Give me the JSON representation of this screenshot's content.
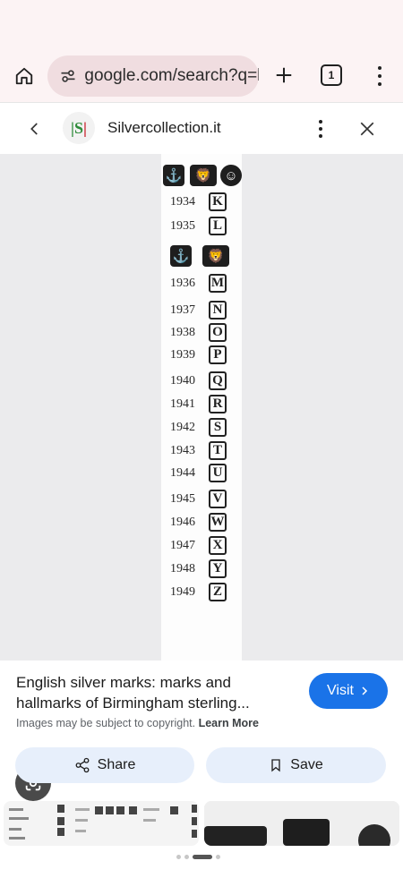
{
  "browser": {
    "url": "google.com/search?q=h",
    "tab_count": "1",
    "icons": [
      "home-icon",
      "tune-icon",
      "plus-icon",
      "tabs-icon",
      "more-vert-icon"
    ]
  },
  "sheet": {
    "site_name": "Silvercollection.it",
    "logo_text": [
      "|S",
      "S",
      "|"
    ]
  },
  "hallmarks": {
    "top_symbols": [
      "⚓",
      "🦁",
      "☺"
    ],
    "mid_symbols": [
      "⚓",
      "🦁"
    ],
    "rows_a": [
      {
        "year": "1934",
        "letter": "K"
      },
      {
        "year": "1935",
        "letter": "L"
      }
    ],
    "rows_b": [
      {
        "year": "1936",
        "letter": "M"
      },
      {
        "year": "1937",
        "letter": "N"
      },
      {
        "year": "1938",
        "letter": "O"
      },
      {
        "year": "1939",
        "letter": "P"
      },
      {
        "year": "1940",
        "letter": "Q"
      },
      {
        "year": "1941",
        "letter": "R"
      },
      {
        "year": "1942",
        "letter": "S"
      },
      {
        "year": "1943",
        "letter": "T"
      },
      {
        "year": "1944",
        "letter": "U"
      },
      {
        "year": "1945",
        "letter": "V"
      },
      {
        "year": "1946",
        "letter": "W"
      },
      {
        "year": "1947",
        "letter": "X"
      },
      {
        "year": "1948",
        "letter": "Y"
      },
      {
        "year": "1949",
        "letter": "Z"
      }
    ]
  },
  "result": {
    "title": "English silver marks: marks and hallmarks of Birmingham sterling...",
    "visit_label": "Visit",
    "copyright_text": "Images may be subject to copyright.",
    "learn_more": "Learn More",
    "share_label": "Share",
    "save_label": "Save"
  }
}
